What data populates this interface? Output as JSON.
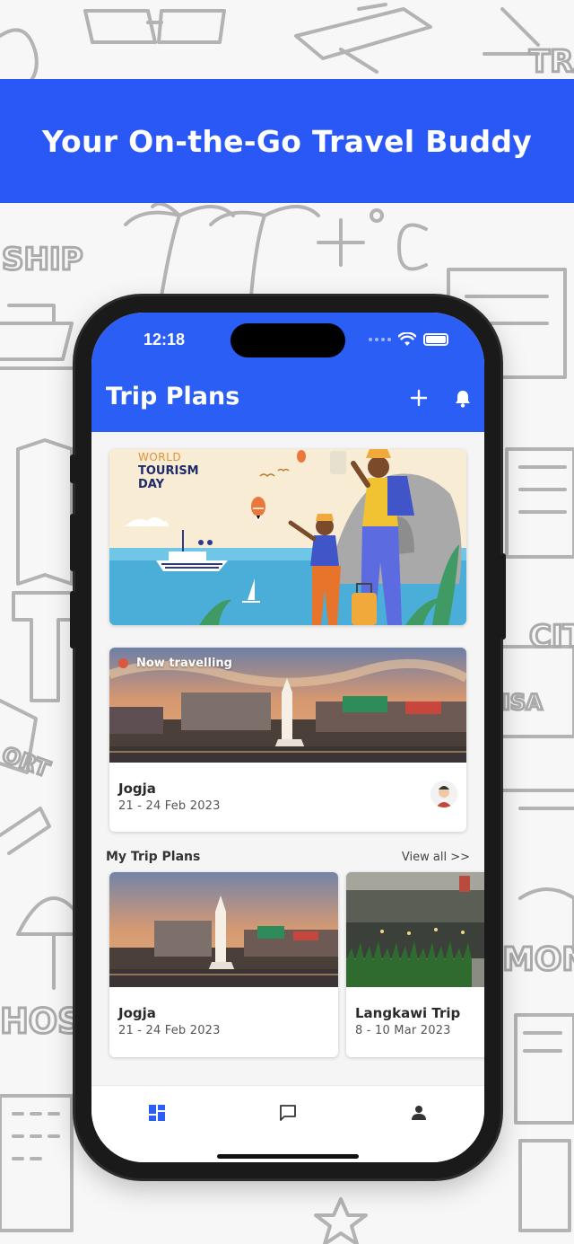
{
  "banner": {
    "headline": "Your On-the-Go Travel Buddy"
  },
  "colors": {
    "brand_blue": "#2b5ef5",
    "banner_blue": "#2958f7",
    "live_dot": "#d9573e"
  },
  "status_bar": {
    "time": "12:18",
    "icons": [
      "signal-dots-icon",
      "wifi-icon",
      "battery-icon"
    ]
  },
  "app_bar": {
    "title": "Trip Plans",
    "actions": [
      {
        "icon": "plus-icon"
      },
      {
        "icon": "bell-icon"
      }
    ]
  },
  "promo_banner": {
    "line1": "WORLD",
    "line2": "TOURISM",
    "line3": "DAY"
  },
  "current_trip": {
    "badge": "Now travelling",
    "title": "Jogja",
    "dates": "21 - 24 Feb 2023",
    "companion_icon": "avatar-icon"
  },
  "my_trips": {
    "heading": "My Trip Plans",
    "view_all": "View all >>",
    "items": [
      {
        "title": "Jogja",
        "dates": "21 - 24 Feb 2023"
      },
      {
        "title": "Langkawi Trip",
        "dates": "8 - 10 Mar 2023"
      }
    ]
  },
  "bottom_nav": {
    "items": [
      {
        "icon": "dashboard-icon",
        "active": true
      },
      {
        "icon": "chat-icon",
        "active": false
      },
      {
        "icon": "profile-icon",
        "active": false
      }
    ]
  },
  "doodle_words": [
    "SHIP",
    "HOST",
    "MONE",
    "CIT",
    "TRA",
    "ORT",
    "ISA"
  ]
}
